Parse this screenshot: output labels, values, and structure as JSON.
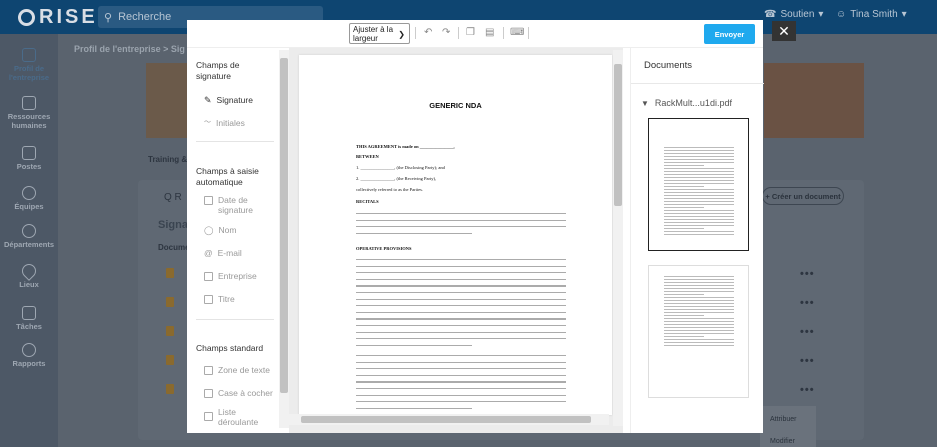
{
  "app": {
    "logo": "RISE",
    "search_placeholder": "Recherche",
    "top_right": {
      "support": "Soutien",
      "user": "Tina Smith"
    }
  },
  "leftnav": [
    {
      "label": "Profil de l'entreprise",
      "active": true
    },
    {
      "label": "Ressources humaines",
      "active": false
    },
    {
      "label": "Postes",
      "active": false
    },
    {
      "label": "Équipes",
      "active": false
    },
    {
      "label": "Départements",
      "active": false
    },
    {
      "label": "Lieux",
      "active": false
    },
    {
      "label": "Tâches",
      "active": false
    },
    {
      "label": "Rapports",
      "active": false
    }
  ],
  "background": {
    "breadcrumb": "Profil de l'entreprise  >  Sig",
    "training": "Training & E",
    "search_prefix": "Q  R",
    "section_title": "Signa",
    "col_header": "Docume",
    "create_doc": "+ Créer un document",
    "row_dots": "•••",
    "context_menu": {
      "assign": "Attribuer",
      "modify": "Modifier"
    }
  },
  "toolbar": {
    "fit_select": "Ajuster à la largeur",
    "send": "Envoyer"
  },
  "fields": {
    "signature_section": "Champs de signature",
    "signature": "Signature",
    "initials": "Initiales",
    "auto_section": "Champs à saisie automatique",
    "sign_date": "Date de signature",
    "name": "Nom",
    "email": "E-mail",
    "company": "Entreprise",
    "title": "Titre",
    "standard_section": "Champs standard",
    "text_zone": "Zone de texte",
    "checkbox": "Case à cocher",
    "dropdown": "Liste déroulante"
  },
  "document": {
    "title": "GENERIC NDA",
    "agreement": "THIS AGREEMENT is made on _______________,",
    "between": "BETWEEN",
    "party1": "1.  _______________, (the Disclosing Party); and",
    "party2": "2.  _______________, (the Receiving Party),",
    "collectively": "collectively referred to as the Parties.",
    "recitals": "RECITALS",
    "operative": "OPERATIVE PROVISIONS"
  },
  "docs_panel": {
    "title": "Documents",
    "file": "RackMult...u1di.pdf"
  }
}
